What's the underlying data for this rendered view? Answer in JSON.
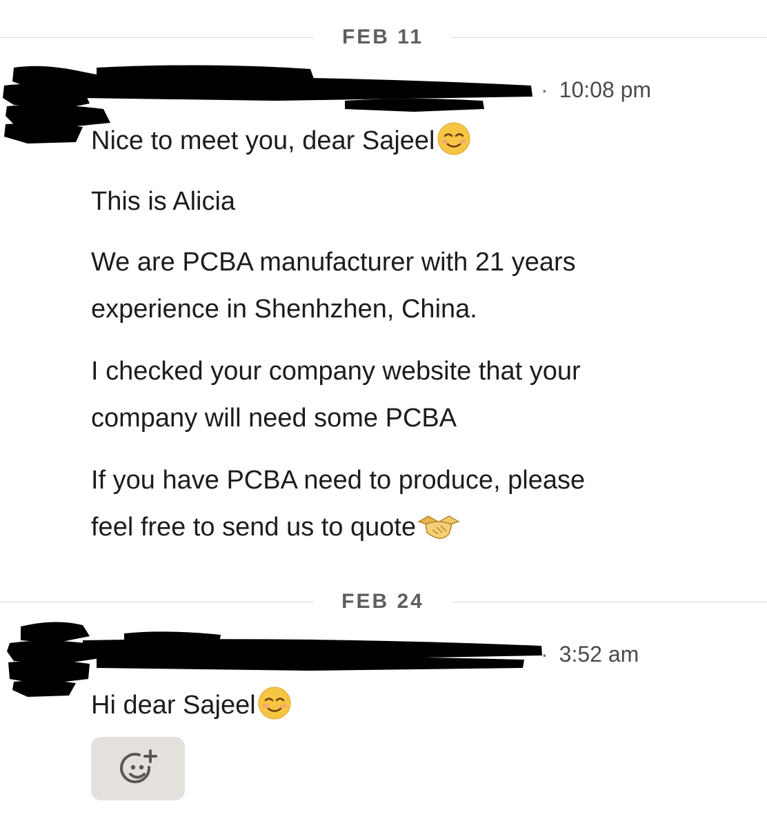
{
  "conversation": {
    "day1": {
      "date_label": "FEB 11",
      "time": "10:08 pm",
      "messages": [
        {
          "text": "Nice to meet you, dear Sajeel"
        },
        {
          "text": "This is Alicia"
        },
        {
          "line1": "We are PCBA manufacturer with 21 years",
          "line2": "experience in Shenhzhen, China."
        },
        {
          "line1": "I checked your company website that your",
          "line2": "company will need some PCBA"
        },
        {
          "line1": "If you have PCBA need to produce, please",
          "line2": "feel free to send us to quote"
        }
      ]
    },
    "day2": {
      "date_label": "FEB 24",
      "time": "3:52 am",
      "messages": [
        {
          "text": "Hi dear Sajeel"
        }
      ]
    }
  },
  "icons": {
    "smile": "smiling-face-emoji",
    "handshake": "handshake-emoji",
    "add_reaction": "add-reaction-icon"
  },
  "colors": {
    "divider_line": "#d9d9d9",
    "date_text": "#5e5e5e",
    "reaction_button_bg": "#e4e1dc"
  }
}
